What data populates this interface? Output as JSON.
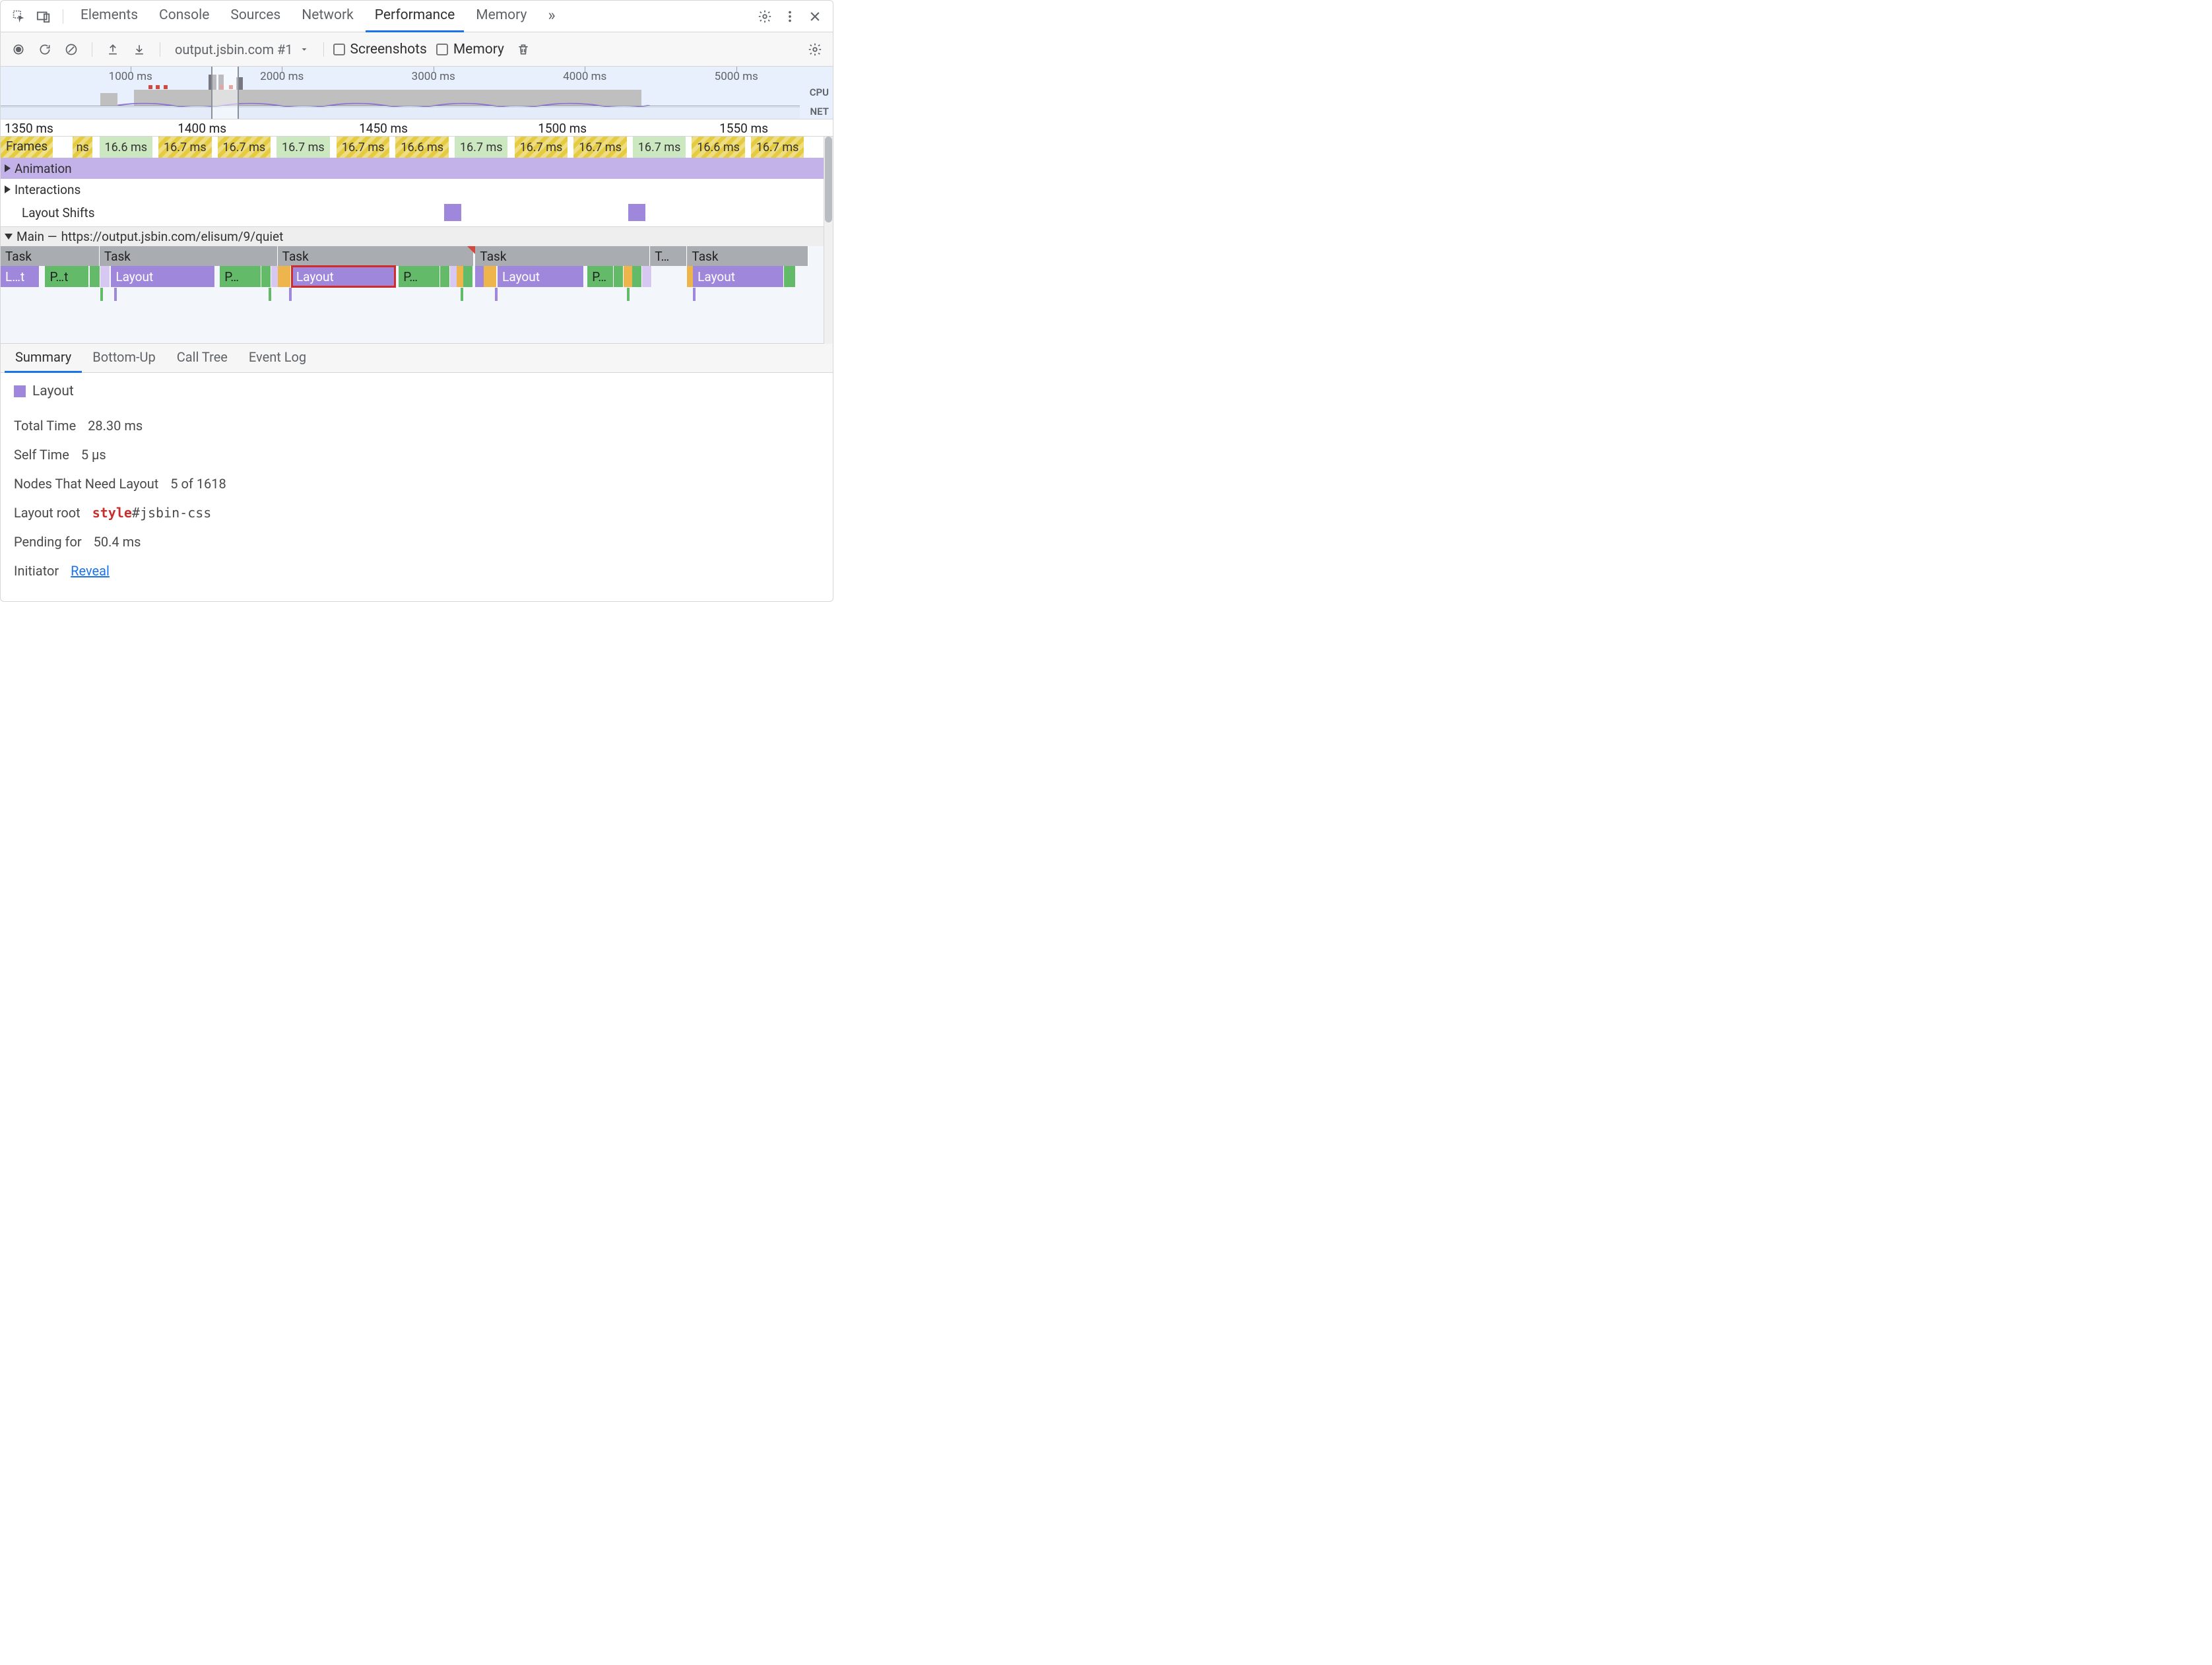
{
  "tabs": {
    "items": [
      "Elements",
      "Console",
      "Sources",
      "Network",
      "Performance",
      "Memory"
    ],
    "active": "Performance",
    "more_glyph": "»"
  },
  "toolbar": {
    "target": "output.jsbin.com #1",
    "screenshots_label": "Screenshots",
    "memory_label": "Memory"
  },
  "overview": {
    "ticks": [
      {
        "label": "1000 ms",
        "pct": 15.6
      },
      {
        "label": "2000 ms",
        "pct": 33.8
      },
      {
        "label": "3000 ms",
        "pct": 52.0
      },
      {
        "label": "4000 ms",
        "pct": 70.2
      },
      {
        "label": "5000 ms",
        "pct": 88.4
      }
    ],
    "side_cpu": "CPU",
    "side_net": "NET"
  },
  "zoom_ruler": {
    "ticks": [
      "1350 ms",
      "1400 ms",
      "1450 ms",
      "1500 ms",
      "1550 ms"
    ]
  },
  "frames": {
    "label": "Frames",
    "items": [
      {
        "label": "ns",
        "type": "y",
        "l": 8.5,
        "w": 2.7
      },
      {
        "label": "16.6 ms",
        "type": "g",
        "l": 11.7,
        "w": 6.7
      },
      {
        "label": "16.7 ms",
        "type": "y",
        "l": 18.8,
        "w": 6.7
      },
      {
        "label": "16.7 ms",
        "type": "y",
        "l": 25.9,
        "w": 6.7
      },
      {
        "label": "16.7 ms",
        "type": "g",
        "l": 33.0,
        "w": 6.7
      },
      {
        "label": "16.7 ms",
        "type": "y",
        "l": 40.2,
        "w": 6.7
      },
      {
        "label": "16.6 ms",
        "type": "y",
        "l": 47.3,
        "w": 6.7
      },
      {
        "label": "16.7 ms",
        "type": "g",
        "l": 54.4,
        "w": 6.7
      },
      {
        "label": "16.7 ms",
        "type": "y",
        "l": 61.6,
        "w": 6.7
      },
      {
        "label": "16.7 ms",
        "type": "y",
        "l": 68.7,
        "w": 6.7
      },
      {
        "label": "16.7 ms",
        "type": "g",
        "l": 75.8,
        "w": 6.7
      },
      {
        "label": "16.6 ms",
        "type": "y",
        "l": 82.9,
        "w": 6.7
      },
      {
        "label": "16.7 ms",
        "type": "y",
        "l": 90.0,
        "w": 6.7
      }
    ]
  },
  "tracks": {
    "animation": "Animation",
    "interactions": "Interactions",
    "layout_shifts": "Layout Shifts",
    "main_prefix": "Main —",
    "main_url": "https://output.jsbin.com/elisum/9/quiet"
  },
  "layout_shifts_marks": [
    53.3,
    75.4
  ],
  "flame": {
    "tasks": [
      {
        "label": "Task",
        "l": 0,
        "w": 12.0
      },
      {
        "label": "Task",
        "l": 12.0,
        "w": 21.6
      },
      {
        "label": "Task",
        "l": 33.6,
        "w": 23.8,
        "marker_red": true,
        "marker_at": 56.6
      },
      {
        "label": "Task",
        "l": 57.6,
        "w": 21.2
      },
      {
        "label": "T…",
        "l": 78.8,
        "w": 4.5
      },
      {
        "label": "Task",
        "l": 83.3,
        "w": 14.7
      }
    ],
    "row2": [
      {
        "label": "L…t",
        "cls": "b-purple",
        "l": 0,
        "w": 4.7
      },
      {
        "label": "P…t",
        "cls": "b-green",
        "l": 5.4,
        "w": 5.3
      },
      {
        "label": "",
        "cls": "b-green",
        "l": 10.8,
        "w": 1.3
      },
      {
        "label": "",
        "cls": "b-purple-st",
        "l": 12.1,
        "w": 1.1
      },
      {
        "label": "Layout",
        "cls": "b-purple",
        "l": 13.4,
        "w": 12.6
      },
      {
        "label": "P…",
        "cls": "b-green",
        "l": 26.6,
        "w": 5.0
      },
      {
        "label": "",
        "cls": "b-green",
        "l": 31.6,
        "w": 1.2
      },
      {
        "label": "",
        "cls": "b-purple-st",
        "l": 32.8,
        "w": 0.8
      },
      {
        "label": "",
        "cls": "b-orange",
        "l": 33.6,
        "w": 1.6
      },
      {
        "label": "Layout",
        "cls": "b-purple b-sel",
        "l": 35.3,
        "w": 12.6
      },
      {
        "label": "P…",
        "cls": "b-green",
        "l": 48.3,
        "w": 5.0
      },
      {
        "label": "",
        "cls": "b-green",
        "l": 53.3,
        "w": 1.2
      },
      {
        "label": "",
        "cls": "b-purple-st",
        "l": 54.5,
        "w": 0.8
      },
      {
        "label": "",
        "cls": "b-orange",
        "l": 55.3,
        "w": 0.8
      },
      {
        "label": "",
        "cls": "b-green",
        "l": 56.1,
        "w": 1.2
      },
      {
        "label": "",
        "cls": "b-purple",
        "l": 57.6,
        "w": 1.0
      },
      {
        "label": "",
        "cls": "b-orange",
        "l": 58.6,
        "w": 1.6
      },
      {
        "label": "Layout",
        "cls": "b-purple",
        "l": 60.3,
        "w": 10.5
      },
      {
        "label": "P…",
        "cls": "b-green",
        "l": 71.2,
        "w": 3.2
      },
      {
        "label": "",
        "cls": "b-green",
        "l": 74.4,
        "w": 1.2
      },
      {
        "label": "",
        "cls": "b-orange",
        "l": 75.6,
        "w": 1.0
      },
      {
        "label": "",
        "cls": "b-green",
        "l": 76.6,
        "w": 1.2
      },
      {
        "label": "",
        "cls": "b-purple-st",
        "l": 77.8,
        "w": 0.8
      },
      {
        "label": "",
        "cls": "b-orange",
        "l": 83.3,
        "w": 0.7
      },
      {
        "label": "Layout",
        "cls": "b-purple",
        "l": 84.0,
        "w": 11.0
      },
      {
        "label": "",
        "cls": "b-green",
        "l": 95.0,
        "w": 1.5
      }
    ],
    "row3": [
      {
        "cls": "b-green",
        "l": 12.1,
        "w": 0.3
      },
      {
        "cls": "b-purple",
        "l": 13.8,
        "w": 0.3
      },
      {
        "cls": "b-green",
        "l": 32.5,
        "w": 0.3
      },
      {
        "cls": "b-purple",
        "l": 35.0,
        "w": 0.3
      },
      {
        "cls": "b-green",
        "l": 55.8,
        "w": 0.3
      },
      {
        "cls": "b-purple",
        "l": 60.0,
        "w": 0.3
      },
      {
        "cls": "b-green",
        "l": 76.0,
        "w": 0.3
      },
      {
        "cls": "b-purple",
        "l": 84.0,
        "w": 0.3
      }
    ]
  },
  "details_tabs": [
    "Summary",
    "Bottom-Up",
    "Call Tree",
    "Event Log"
  ],
  "details_active": "Summary",
  "summary": {
    "title": "Layout",
    "rows": [
      {
        "k": "Total Time",
        "v": "28.30 ms"
      },
      {
        "k": "Self Time",
        "v": "5 µs"
      },
      {
        "k": "Nodes That Need Layout",
        "v": "5 of 1618"
      },
      {
        "k": "Layout root",
        "style_tag": "style",
        "style_sel": "#jsbin-css"
      },
      {
        "k": "Pending for",
        "v": "50.4 ms"
      },
      {
        "k": "Initiator",
        "link": "Reveal"
      }
    ]
  }
}
